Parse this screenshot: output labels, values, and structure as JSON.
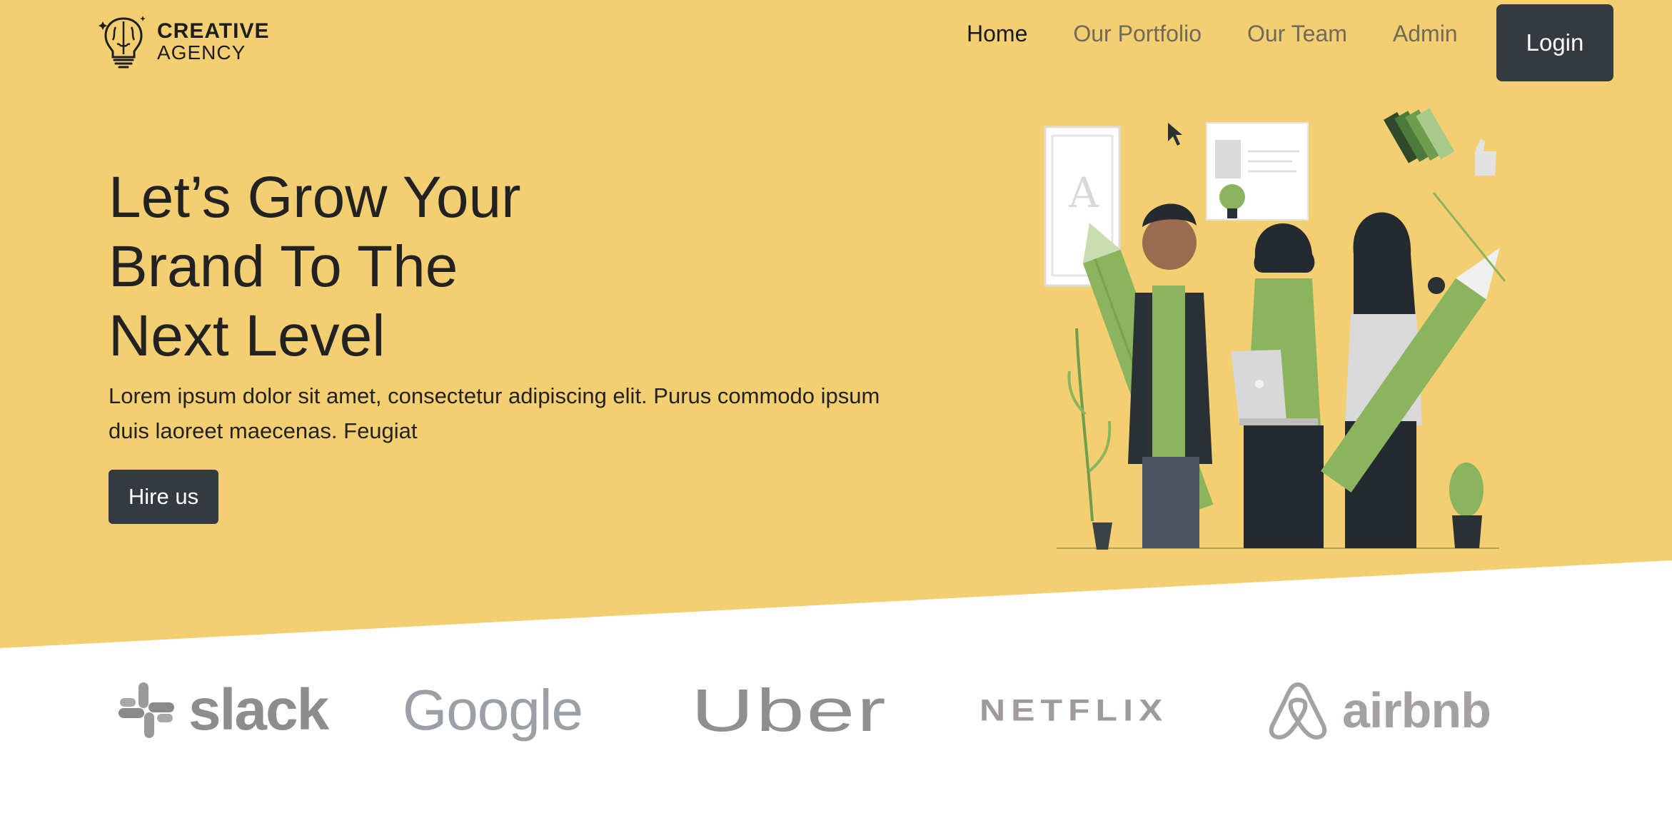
{
  "brand": {
    "line1": "CREATIVE",
    "line2": "AGENCY",
    "icon": "brain-lightbulb-icon"
  },
  "nav": {
    "links": [
      {
        "label": "Home",
        "active": true
      },
      {
        "label": "Our Portfolio",
        "active": false
      },
      {
        "label": "Our Team",
        "active": false
      },
      {
        "label": "Admin",
        "active": false
      }
    ],
    "login_label": "Login"
  },
  "hero": {
    "title_lines": [
      "Let’s Grow Your",
      "Brand To The",
      "Next Level"
    ],
    "description": "Lorem ipsum dolor sit amet, consectetur adipiscing elit. Purus commodo ipsum duis laoreet maecenas. Feugiat",
    "cta_label": "Hire us",
    "illustration": "team-with-pencil-illustration"
  },
  "clients": [
    {
      "name": "slack",
      "icon": "slack-hash-icon"
    },
    {
      "name": "Google"
    },
    {
      "name": "Uber"
    },
    {
      "name": "NETFLIX"
    },
    {
      "name": "airbnb",
      "icon": "airbnb-belo-icon"
    }
  ],
  "colors": {
    "hero_bg": "#f3cf72",
    "button_dark": "#343a40",
    "text_dark": "#212529",
    "accent_green": "#8ab45e"
  }
}
